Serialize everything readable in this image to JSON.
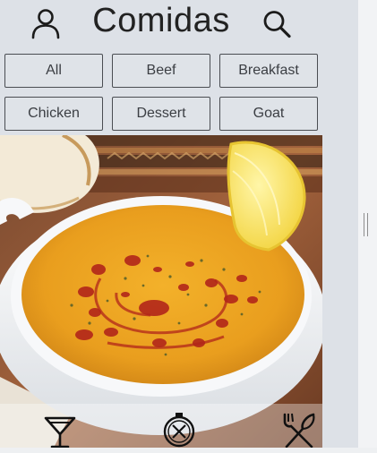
{
  "header": {
    "title": "Comidas",
    "profile_icon": "user-icon",
    "search_icon": "search-icon"
  },
  "categories": [
    {
      "label": "All"
    },
    {
      "label": "Beef"
    },
    {
      "label": "Breakfast"
    },
    {
      "label": "Chicken"
    },
    {
      "label": "Dessert"
    },
    {
      "label": "Goat"
    }
  ],
  "featured": {
    "image": "lentil-soup-photo"
  },
  "bottom_nav": [
    {
      "icon": "cocktail-icon"
    },
    {
      "icon": "compass-icon"
    },
    {
      "icon": "fork-knife-icon"
    }
  ],
  "colors": {
    "background": "#dde1e7",
    "button_border": "#4a4d52",
    "text": "#222222"
  }
}
